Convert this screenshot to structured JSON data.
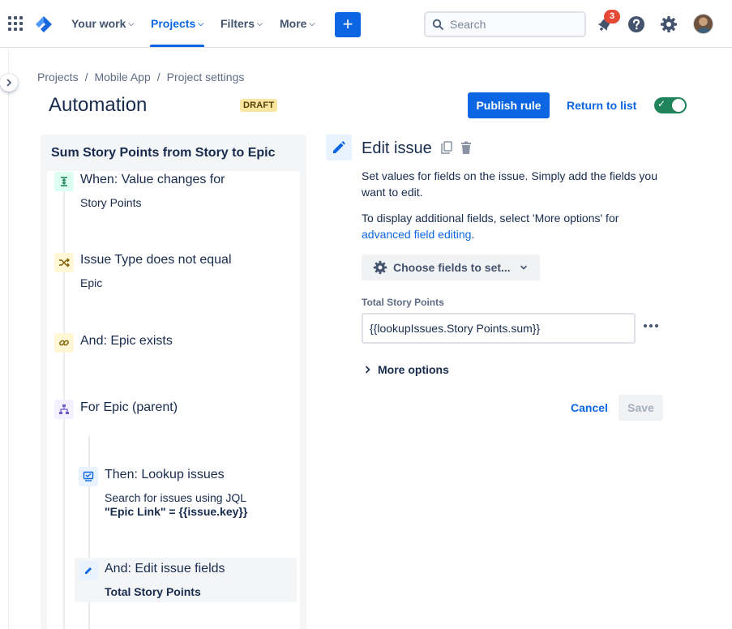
{
  "nav": {
    "items": [
      {
        "label": "Your work"
      },
      {
        "label": "Projects"
      },
      {
        "label": "Filters"
      },
      {
        "label": "More"
      }
    ],
    "active_item": "Projects",
    "create_label": "+",
    "search_placeholder": "Search",
    "notification_count": "3",
    "icons": [
      "app-switcher-icon",
      "jira-logo-icon",
      "search-icon",
      "notifications-icon",
      "help-icon",
      "settings-icon",
      "avatar"
    ]
  },
  "breadcrumb": [
    "Projects",
    "Mobile App",
    "Project settings"
  ],
  "header": {
    "title": "Automation",
    "status_badge": "DRAFT",
    "publish_label": "Publish rule",
    "return_label": "Return to list",
    "rule_enabled": true
  },
  "rule": {
    "name": "Sum Story Points from Story to Epic",
    "components": [
      {
        "type": "trigger",
        "title": "When: Value changes for",
        "subtitle": "Story Points",
        "icon": "trigger-icon",
        "color": "#dcfff1"
      },
      {
        "type": "condition",
        "title": "Issue Type does not equal",
        "subtitle": "Epic",
        "icon": "shuffle-icon",
        "color": "#fff7d6"
      },
      {
        "type": "condition",
        "title": "And: Epic exists",
        "subtitle": "",
        "icon": "link-icon",
        "color": "#fff7d6"
      },
      {
        "type": "branch",
        "title": "For Epic (parent)",
        "subtitle": "",
        "icon": "hierarchy-icon",
        "color": "#f3f0ff"
      },
      {
        "type": "action",
        "title": "Then: Lookup issues",
        "subtitle": "Search for issues using JQL",
        "subtitle2": "\"Epic Link\" = {{issue.key}}",
        "icon": "lookup-icon",
        "color": "#e9f2ff"
      },
      {
        "type": "action",
        "title": "And: Edit issue fields",
        "subtitle": "Total Story Points",
        "icon": "pencil-icon",
        "color": "#e9f2ff"
      }
    ]
  },
  "editor": {
    "title": "Edit issue",
    "description1": "Set values for fields on the issue. Simply add the fields you want to edit.",
    "description2_prefix": "To display additional fields, select 'More options' for",
    "description2_link": "advanced field editing",
    "description2_suffix": ".",
    "choose_fields_label": "Choose fields to set...",
    "field_label": "Total Story Points",
    "field_value": "{{lookupIssues.Story Points.sum}}",
    "more_options_label": "More options",
    "cancel_label": "Cancel",
    "save_label": "Save"
  },
  "colors": {
    "brand_blue": "#0c66e4",
    "toggle_on": "#1f845a",
    "draft_badge": "#f8e6a0",
    "notification": "#e34935"
  }
}
